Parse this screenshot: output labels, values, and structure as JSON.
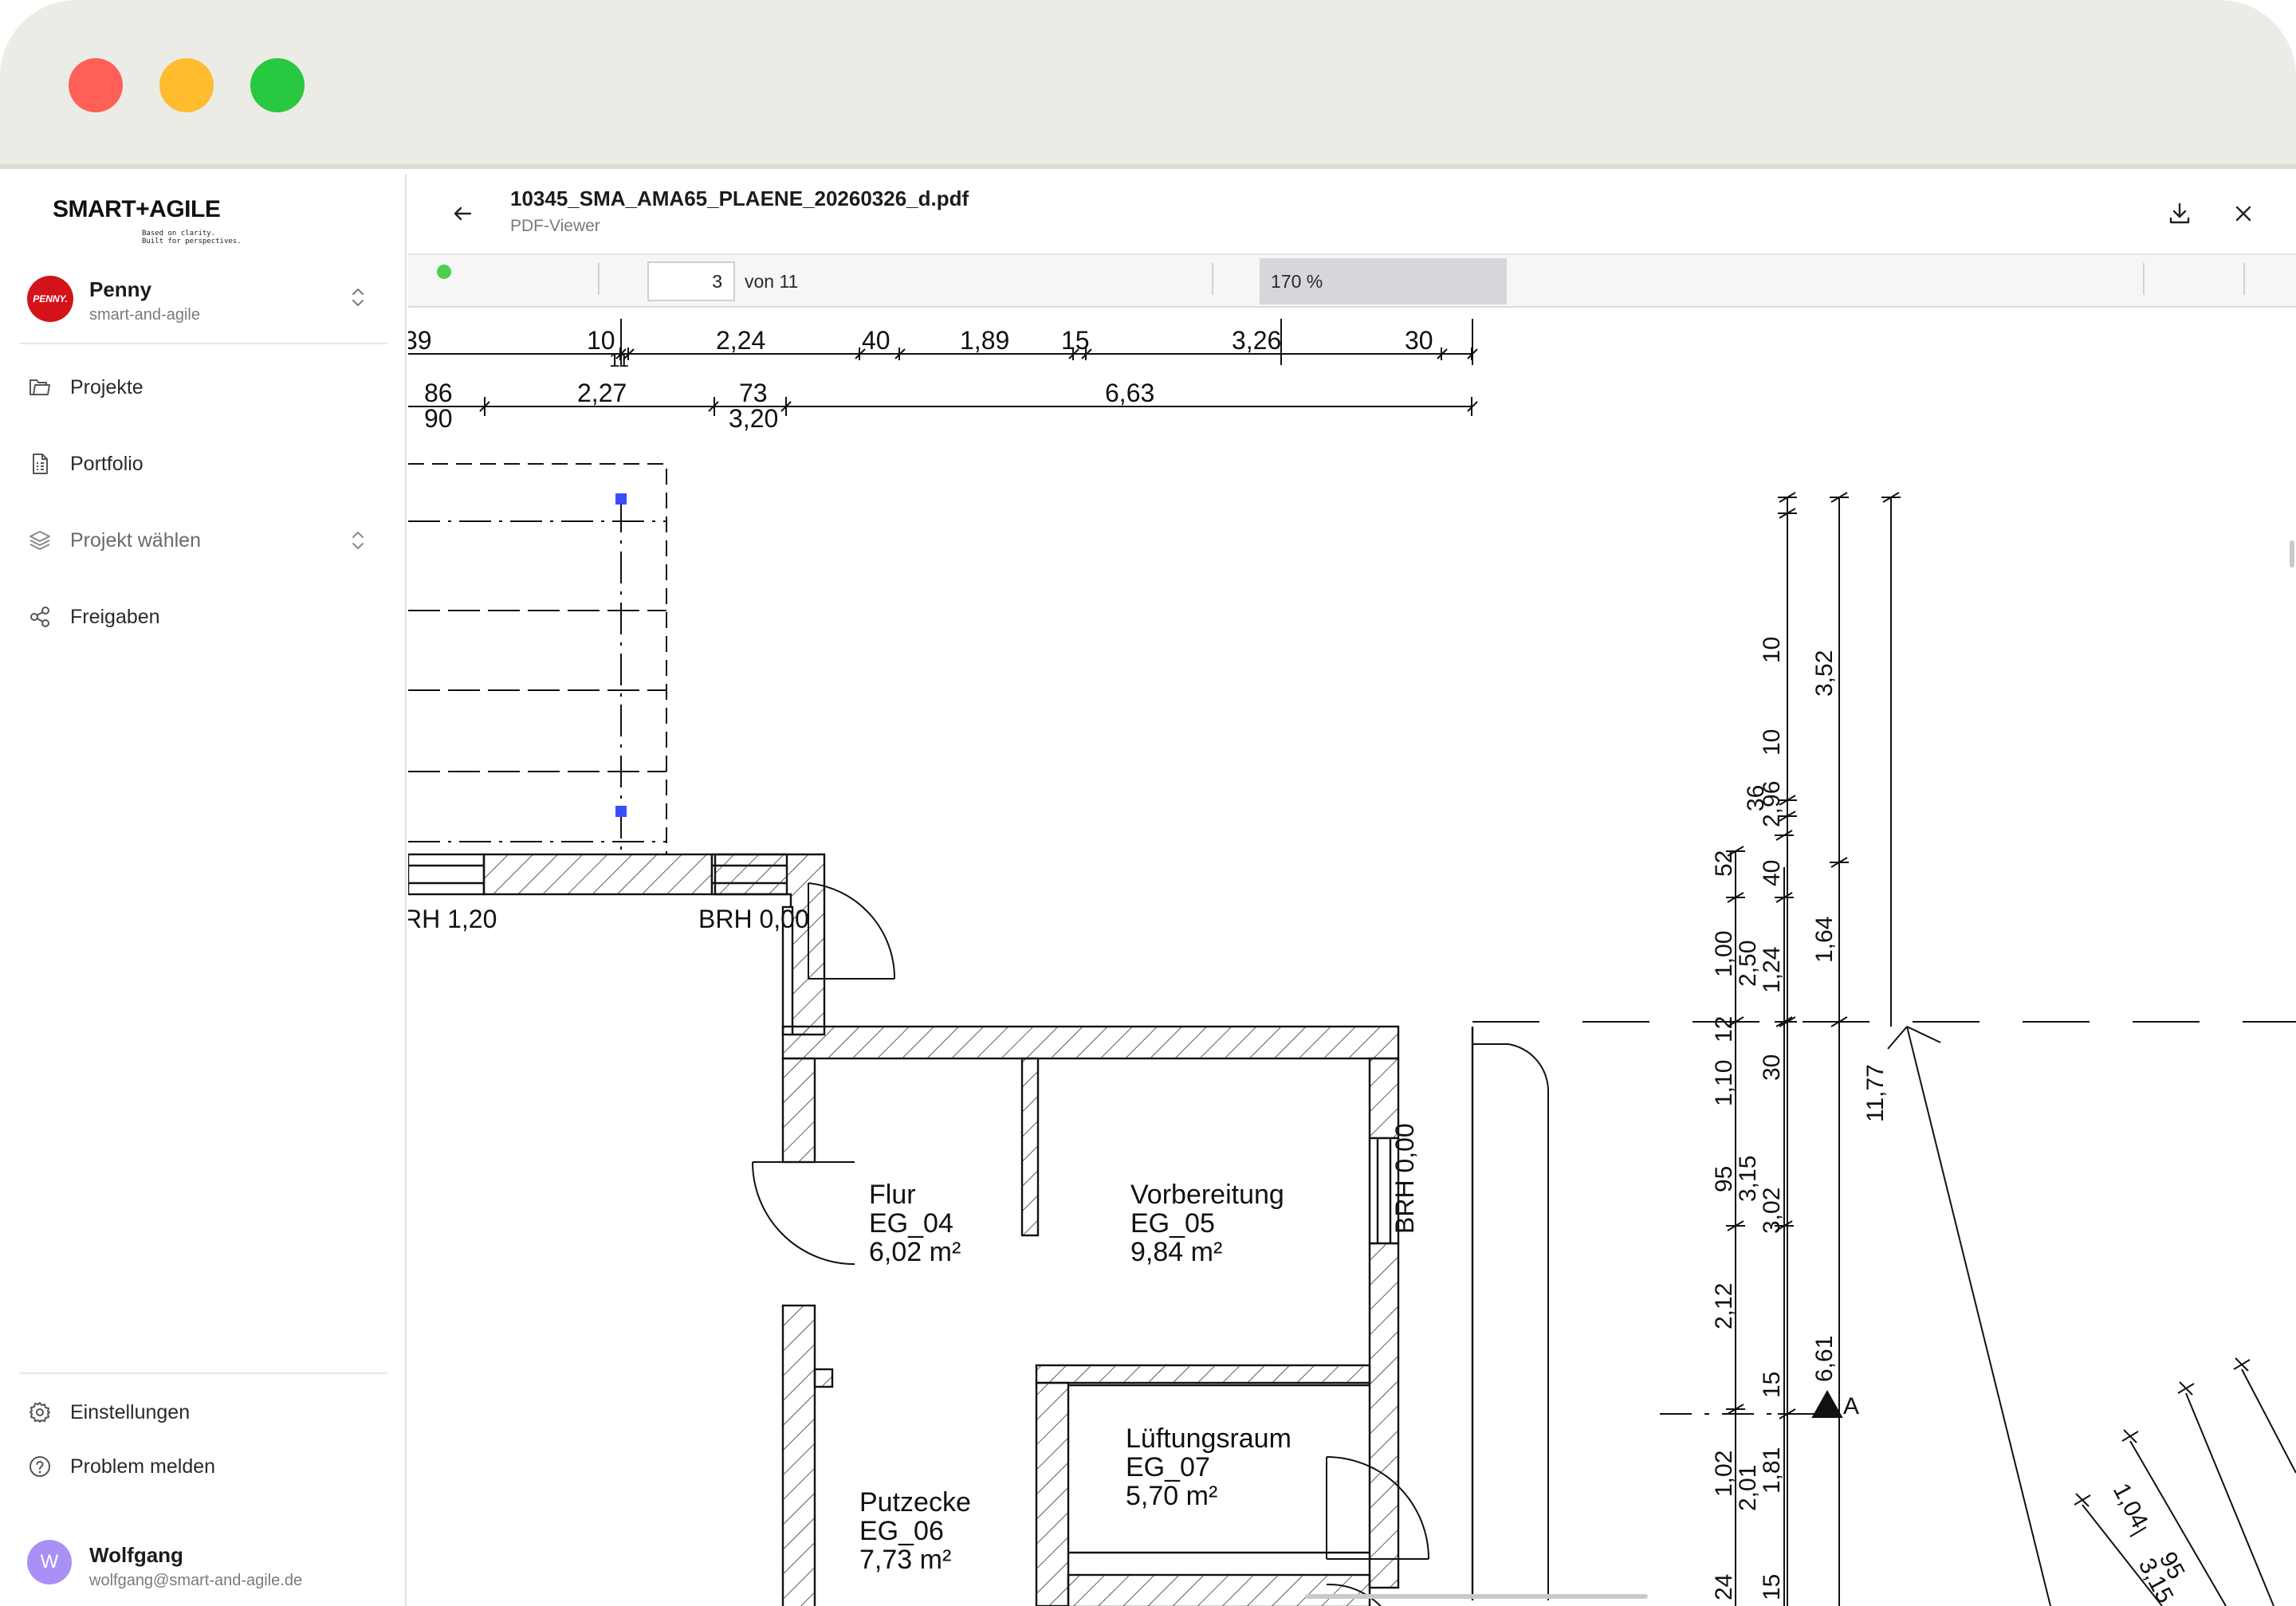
{
  "window": {
    "controls": [
      "close",
      "minimize",
      "maximize"
    ]
  },
  "sidebar": {
    "logo": {
      "text": "SMART+AGILE",
      "tagline_1": "Based on clarity.",
      "tagline_2": "Built for perspectives."
    },
    "account": {
      "avatar_text": "PENNY.",
      "name": "Penny",
      "slug": "smart-and-agile",
      "avatar_color": "#d3121a"
    },
    "nav": [
      {
        "label": "Projekte",
        "icon": "folder-icon"
      },
      {
        "label": "Portfolio",
        "icon": "document-icon"
      },
      {
        "label": "Projekt wählen",
        "icon": "layers-icon"
      },
      {
        "label": "Freigaben",
        "icon": "share-icon"
      }
    ],
    "bottom_nav": [
      {
        "label": "Einstellungen",
        "icon": "gear-icon"
      },
      {
        "label": "Problem melden",
        "icon": "help-icon"
      }
    ],
    "user": {
      "initial": "W",
      "name": "Wolfgang",
      "email": "wolfgang@smart-and-agile.de",
      "avatar_color": "#a990f5"
    }
  },
  "viewer": {
    "file_name": "10345_SMA_AMA65_PLAENE_20260326_d.pdf",
    "subtitle": "PDF-Viewer",
    "page_current": "3",
    "page_of": "von 11",
    "zoom": "170 %",
    "status_color": "#4cd04c"
  },
  "drawing": {
    "dim_top_row1": [
      "39",
      "10",
      "11",
      "2,24",
      "40",
      "1,89",
      "15",
      "3,26",
      "30"
    ],
    "dim_top_row2": [
      "86",
      "90",
      "2,27",
      "73",
      "3,20",
      "6,63"
    ],
    "brh_labels": [
      "RH 1,20",
      "BRH 0,00",
      "BRH 0,00"
    ],
    "rooms": [
      {
        "name": "Flur",
        "id": "EG_04",
        "area": "6,02 m²"
      },
      {
        "name": "Vorbereitung",
        "id": "EG_05",
        "area": "9,84 m²"
      },
      {
        "name": "Lüftungsraum",
        "id": "EG_07",
        "area": "5,70 m²"
      },
      {
        "name": "Putzecke",
        "id": "EG_06",
        "area": "7,73 m²"
      }
    ],
    "dim_right_col1": [
      "52",
      "1,00",
      "12",
      "1,10",
      "95",
      "2,12",
      "1,02",
      "24"
    ],
    "dim_right_col2": [
      "36",
      "40",
      "2,50",
      "30",
      "3,15",
      "15",
      "2,01"
    ],
    "dim_right_col3": [
      "10",
      "2,96",
      "10",
      "1,24",
      "3,02",
      "1,81",
      "15"
    ],
    "dim_right_col4": [
      "3,52",
      "1,64",
      "6,61"
    ],
    "dim_right_col5": [
      "11,77"
    ],
    "section_marker": "A",
    "dim_diag": [
      "1,04",
      "95",
      "3,15"
    ]
  }
}
